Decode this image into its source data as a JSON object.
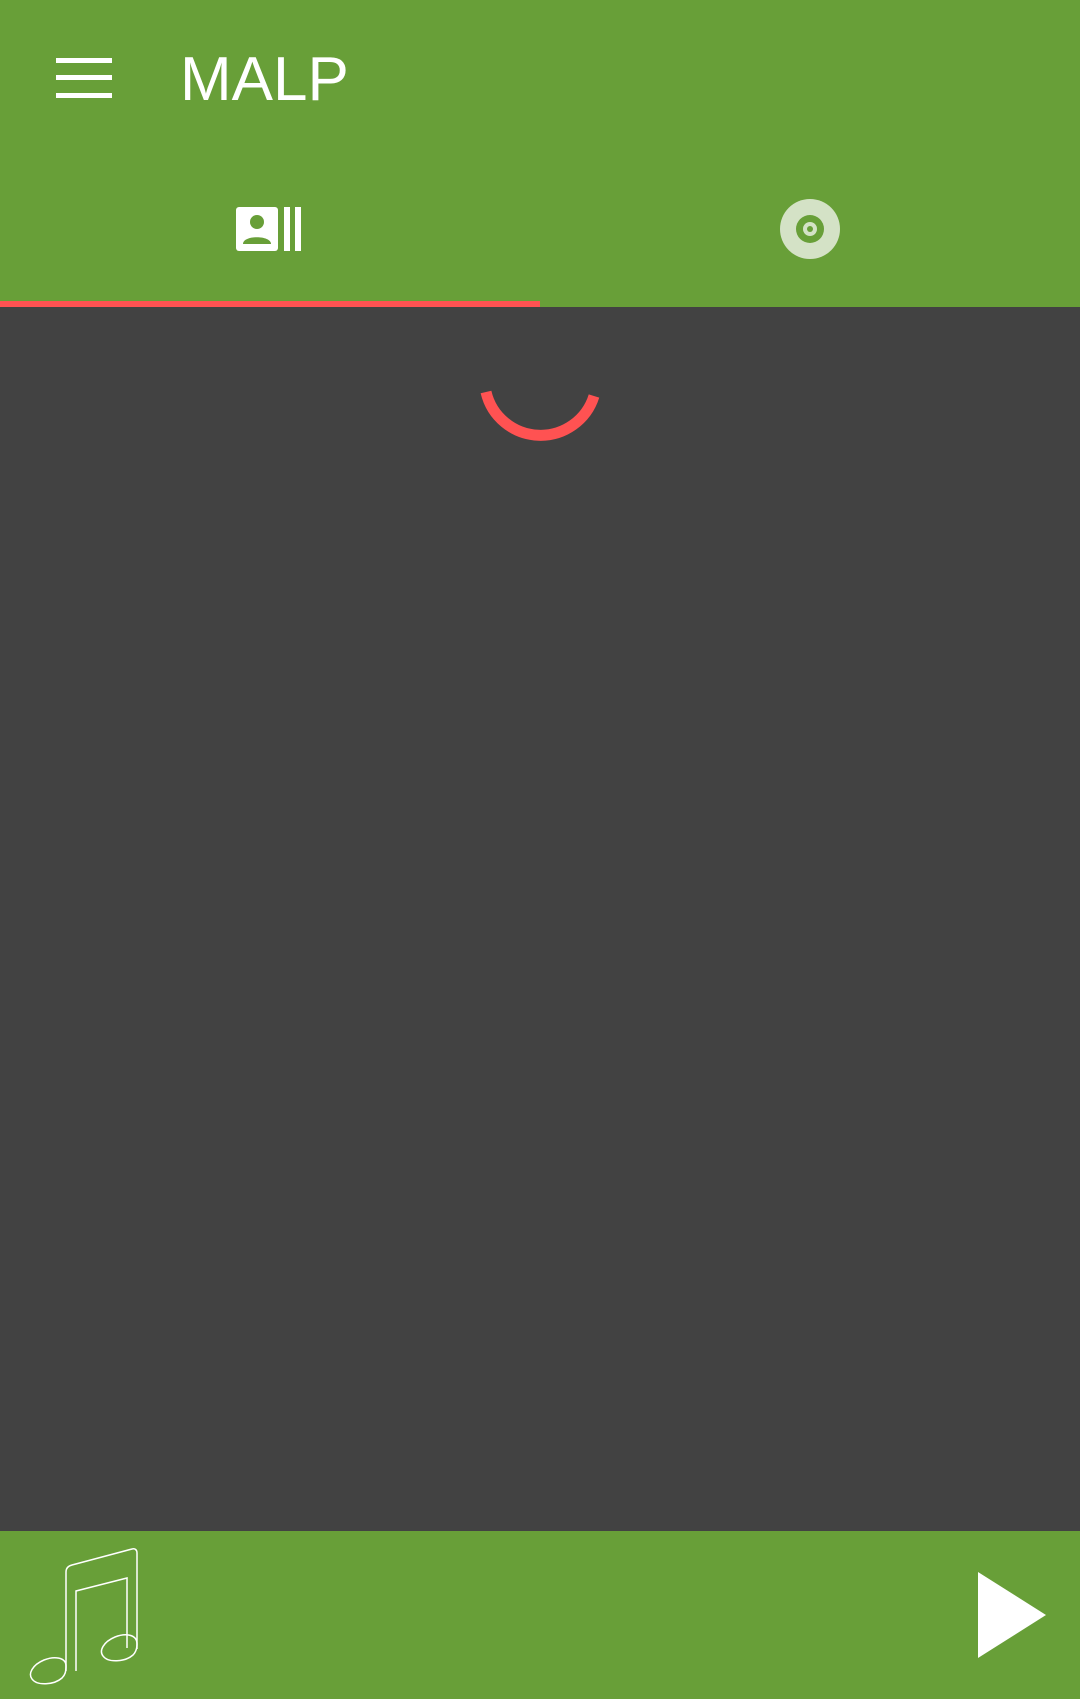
{
  "app": {
    "title": "MALP"
  },
  "toolbar": {
    "menu_icon": "hamburger-menu-icon"
  },
  "tabs": [
    {
      "icon": "artists-icon",
      "selected": true
    },
    {
      "icon": "album-disc-icon",
      "selected": false
    }
  ],
  "content": {
    "state": "loading",
    "spinner_icon": "loading-spinner-icon"
  },
  "now_playing": {
    "cover_icon": "music-note-icon",
    "play_icon": "play-icon"
  },
  "colors": {
    "primary": "#689f38",
    "accent": "#ff5252",
    "background": "#424242",
    "on_primary": "#ffffff"
  }
}
